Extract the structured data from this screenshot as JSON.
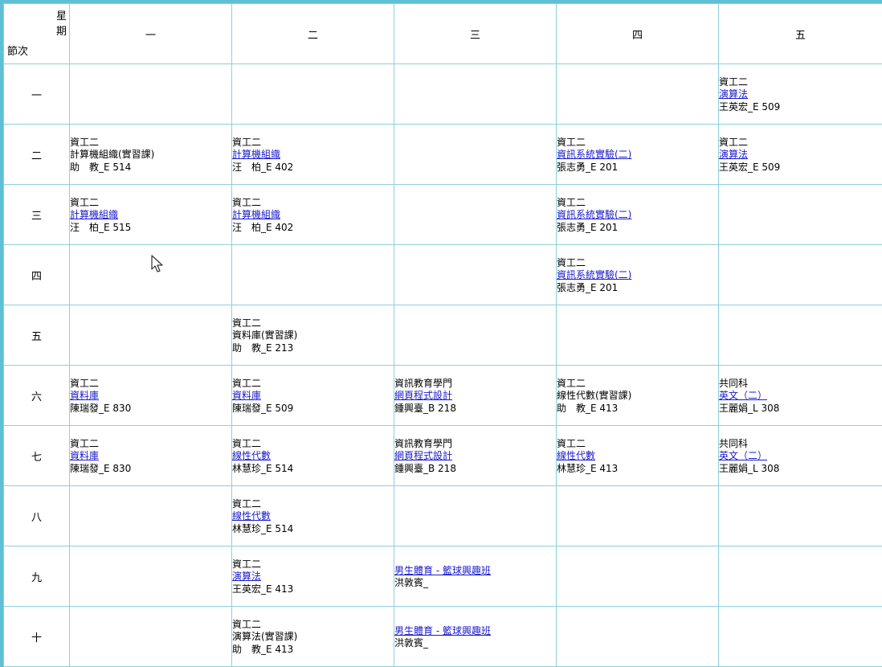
{
  "header": {
    "corner_day_char1": "星",
    "corner_day_char2": "期",
    "corner_period": "節次",
    "days": [
      "一",
      "二",
      "三",
      "四",
      "五"
    ]
  },
  "rows": [
    {
      "period": "一",
      "cells": [
        null,
        null,
        null,
        null,
        {
          "dept": "資工二",
          "course": "演算法",
          "link": true,
          "teacher": "王英宏_E 509"
        }
      ]
    },
    {
      "period": "二",
      "cells": [
        {
          "dept": "資工二",
          "course": "計算機組織(實習課)",
          "link": false,
          "teacher": "助　教_E 514"
        },
        {
          "dept": "資工二",
          "course": "計算機組織",
          "link": true,
          "teacher": "汪　柏_E 402"
        },
        null,
        {
          "dept": "資工二",
          "course": "資訊系統實驗(二)",
          "link": true,
          "teacher": "張志勇_E 201"
        },
        {
          "dept": "資工二",
          "course": "演算法",
          "link": true,
          "teacher": "王英宏_E 509"
        }
      ]
    },
    {
      "period": "三",
      "cells": [
        {
          "dept": "資工二",
          "course": "計算機組織",
          "link": true,
          "teacher": "汪　柏_E 515"
        },
        {
          "dept": "資工二",
          "course": "計算機組織",
          "link": true,
          "teacher": "汪　柏_E 402"
        },
        null,
        {
          "dept": "資工二",
          "course": "資訊系統實驗(二)",
          "link": true,
          "teacher": "張志勇_E 201"
        },
        null
      ]
    },
    {
      "period": "四",
      "cells": [
        null,
        null,
        null,
        {
          "dept": "資工二",
          "course": "資訊系統實驗(二)",
          "link": true,
          "teacher": "張志勇_E 201"
        },
        null
      ]
    },
    {
      "period": "五",
      "cells": [
        null,
        {
          "dept": "資工二",
          "course": "資料庫(實習課)",
          "link": false,
          "teacher": "助　教_E 213"
        },
        null,
        null,
        null
      ]
    },
    {
      "period": "六",
      "cells": [
        {
          "dept": "資工二",
          "course": "資料庫",
          "link": true,
          "teacher": "陳瑞發_E 830"
        },
        {
          "dept": "資工二",
          "course": "資料庫",
          "link": true,
          "teacher": "陳瑞發_E 509"
        },
        {
          "dept": "資訊教育學門",
          "course": "網頁程式設計",
          "link": true,
          "teacher": "鍾興臺_B 218"
        },
        {
          "dept": "資工二",
          "course": "線性代數(實習課)",
          "link": false,
          "teacher": "助　教_E 413"
        },
        {
          "dept": "共同科",
          "course": "英文（二）",
          "link": true,
          "teacher": "王麗娟_L 308"
        }
      ]
    },
    {
      "period": "七",
      "cells": [
        {
          "dept": "資工二",
          "course": "資料庫",
          "link": true,
          "teacher": "陳瑞發_E 830"
        },
        {
          "dept": "資工二",
          "course": "線性代數",
          "link": true,
          "teacher": "林慧珍_E 514"
        },
        {
          "dept": "資訊教育學門",
          "course": "網頁程式設計",
          "link": true,
          "teacher": "鍾興臺_B 218"
        },
        {
          "dept": "資工二",
          "course": "線性代數",
          "link": true,
          "teacher": "林慧珍_E 413"
        },
        {
          "dept": "共同科",
          "course": "英文（二）",
          "link": true,
          "teacher": "王麗娟_L 308"
        }
      ]
    },
    {
      "period": "八",
      "cells": [
        null,
        {
          "dept": "資工二",
          "course": "線性代數",
          "link": true,
          "teacher": "林慧珍_E 514"
        },
        null,
        null,
        null
      ]
    },
    {
      "period": "九",
      "cells": [
        null,
        {
          "dept": "資工二",
          "course": "演算法",
          "link": true,
          "teacher": "王英宏_E 413"
        },
        {
          "dept": "",
          "course": "男生體育 - 籃球興趣班",
          "link": true,
          "teacher": "洪敦賓_"
        },
        null,
        null
      ]
    },
    {
      "period": "十",
      "cells": [
        null,
        {
          "dept": "資工二",
          "course": "演算法(實習課)",
          "link": false,
          "teacher": "助　教_E 413"
        },
        {
          "dept": "",
          "course": "男生體育 - 籃球興趣班",
          "link": true,
          "teacher": "洪敦賓_"
        },
        null,
        null
      ]
    }
  ],
  "colors": {
    "frame_border": "#5fc0d4",
    "grid_line": "#8fcfdc",
    "link": "#1a1acc"
  }
}
